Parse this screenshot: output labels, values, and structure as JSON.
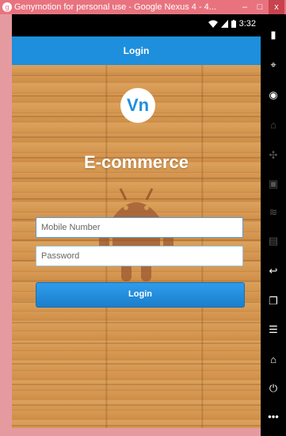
{
  "window": {
    "title": "Genymotion for personal use - Google Nexus 4 - 4...",
    "minimize": "–",
    "maximize": "□",
    "close": "x"
  },
  "status_bar": {
    "time": "3:32"
  },
  "action_bar": {
    "title": "Login"
  },
  "logo": {
    "text": "Vn"
  },
  "brand": {
    "title": "E-commerce"
  },
  "form": {
    "mobile_placeholder": "Mobile Number",
    "password_placeholder": "Password",
    "login_label": "Login"
  },
  "colors": {
    "action_bar": "#1e8fdc",
    "button": "#1a7fcc",
    "window_frame": "#e8737f",
    "wood": "#d79a55"
  },
  "side_panel": {
    "icons": [
      "battery-icon",
      "gps-icon",
      "camera-icon",
      "rotate-icon",
      "dpad-icon",
      "capture-icon",
      "rss-icon",
      "id-icon",
      "back-icon",
      "recent-apps-icon",
      "menu-icon",
      "home-icon",
      "power-icon",
      "more-icon"
    ]
  }
}
